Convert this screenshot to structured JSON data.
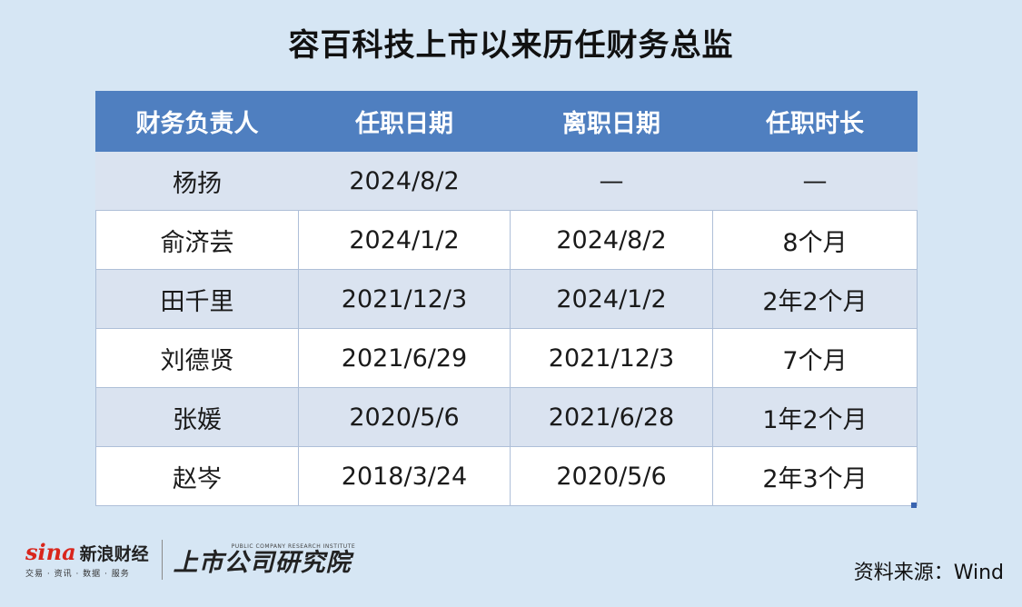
{
  "title": "容百科技上市以来历任财务总监",
  "table": {
    "headers": [
      "财务负责人",
      "任职日期",
      "离职日期",
      "任职时长"
    ],
    "rows": [
      [
        "杨扬",
        "2024/8/2",
        "—",
        "—"
      ],
      [
        "俞济芸",
        "2024/1/2",
        "2024/8/2",
        "8个月"
      ],
      [
        "田千里",
        "2021/12/3",
        "2024/1/2",
        "2年2个月"
      ],
      [
        "刘德贤",
        "2021/6/29",
        "2021/12/3",
        "7个月"
      ],
      [
        "张媛",
        "2020/5/6",
        "2021/6/28",
        "1年2个月"
      ],
      [
        "赵岑",
        "2018/3/24",
        "2020/5/6",
        "2年3个月"
      ]
    ]
  },
  "footer": {
    "sina_word": "sina",
    "sina_name": "新浪财经",
    "sina_sub": "交易 · 资讯 · 数据 · 服务",
    "institute_en": "PUBLIC COMPANY RESEARCH INSTITUTE",
    "institute_cn": "上市公司研究院",
    "source": "资料来源：Wind"
  }
}
